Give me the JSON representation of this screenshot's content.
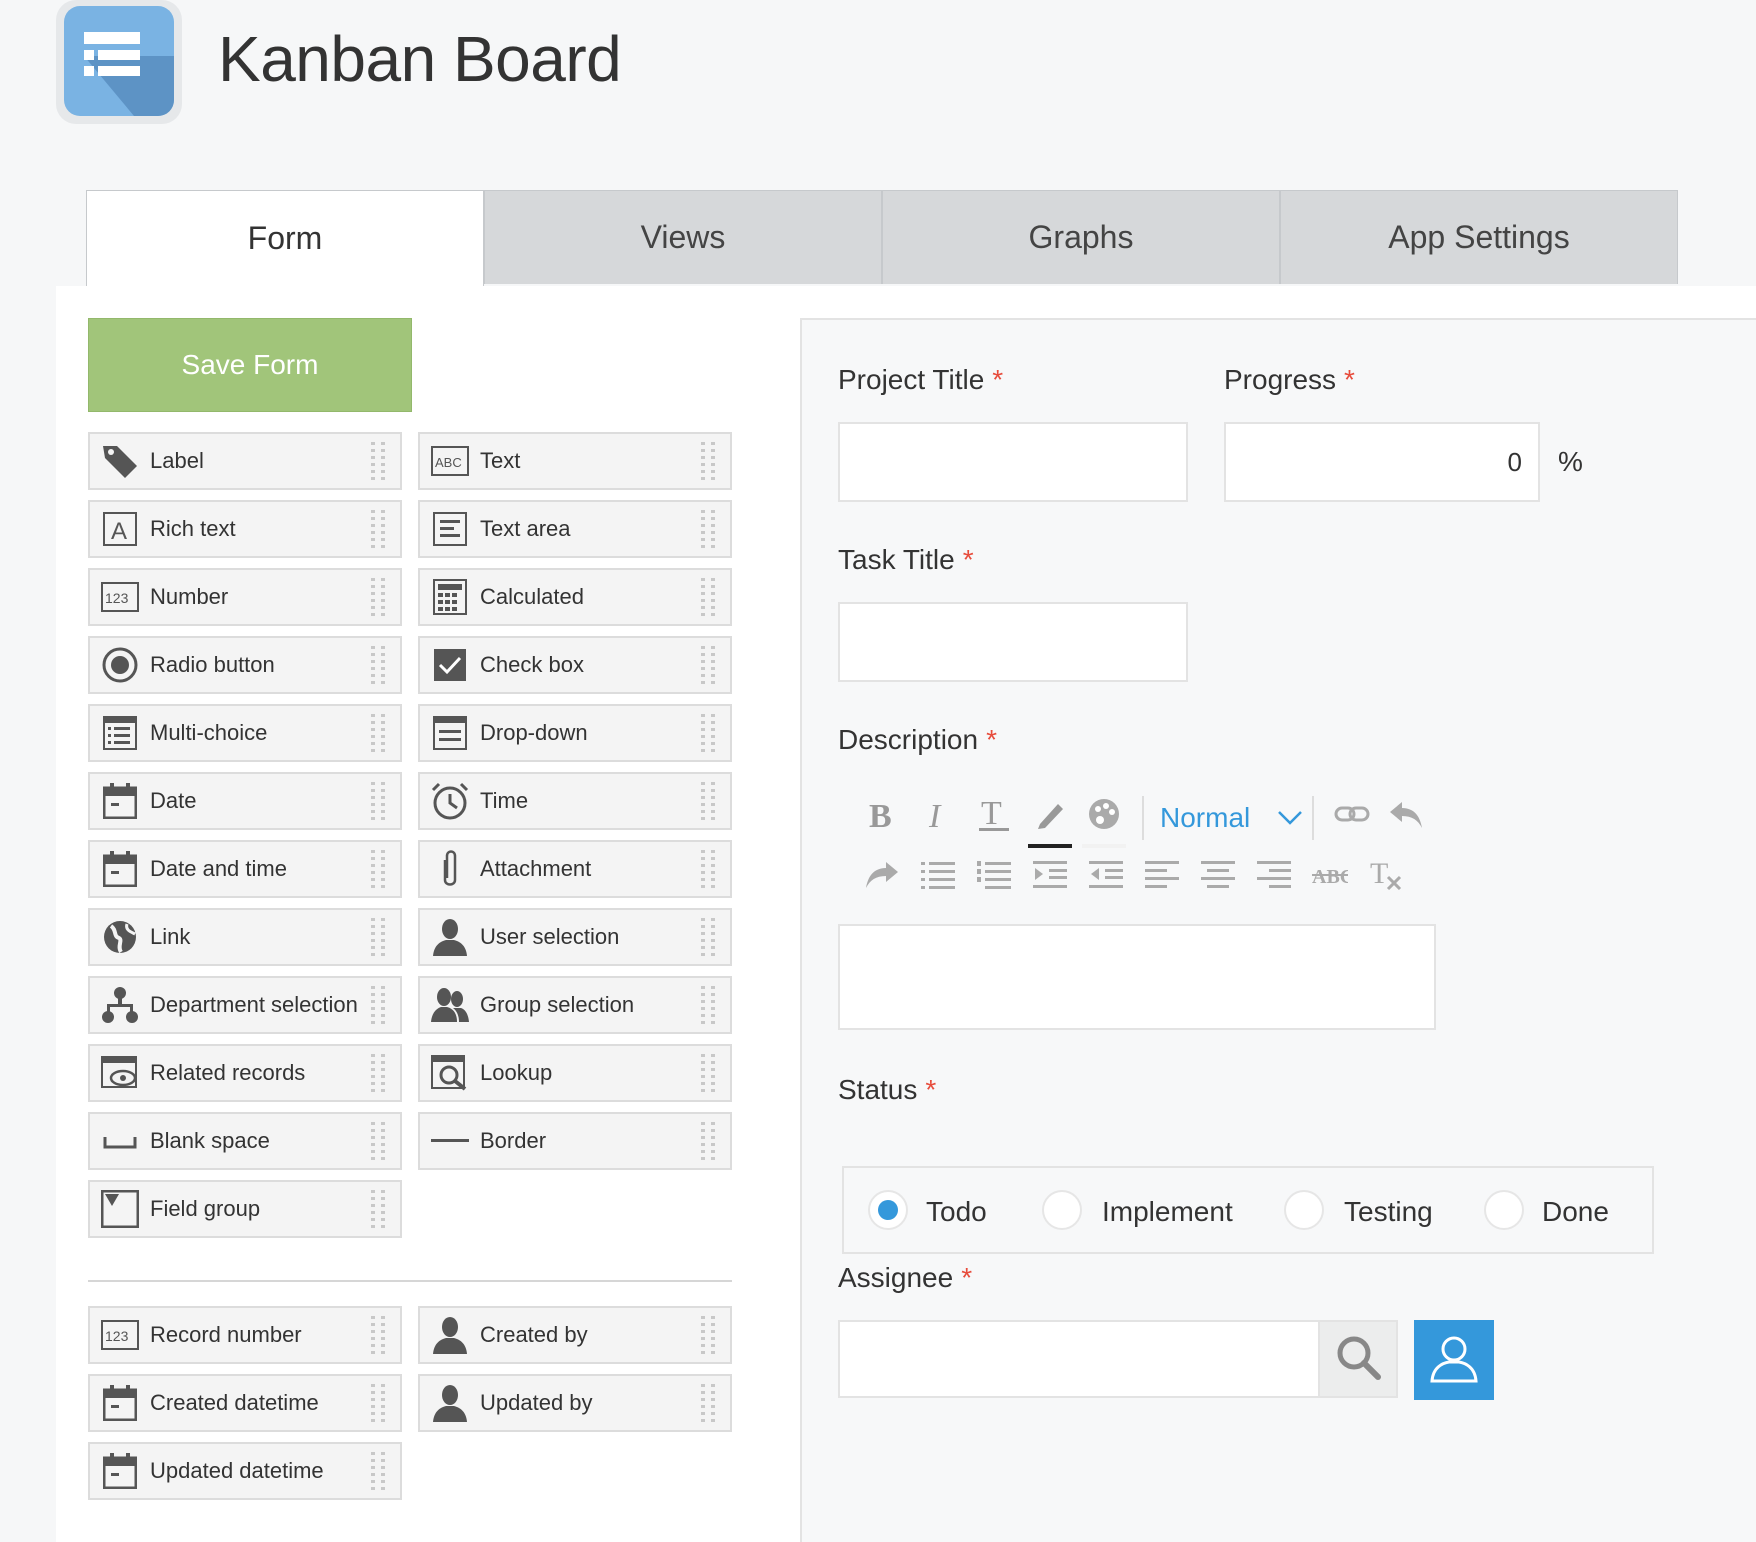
{
  "app": {
    "title": "Kanban Board",
    "icon": "list-icon",
    "icon_color": "#7ab3e3"
  },
  "tabs": [
    {
      "label": "Form",
      "active": true
    },
    {
      "label": "Views",
      "active": false
    },
    {
      "label": "Graphs",
      "active": false
    },
    {
      "label": "App Settings",
      "active": false
    }
  ],
  "toolbar": {
    "save_label": "Save Form",
    "save_color": "#a1c57a"
  },
  "palette": {
    "fields": [
      {
        "label": "Label",
        "icon": "tag-icon"
      },
      {
        "label": "Text",
        "icon": "abc-icon"
      },
      {
        "label": "Rich text",
        "icon": "rich-text-icon"
      },
      {
        "label": "Text area",
        "icon": "text-area-icon"
      },
      {
        "label": "Number",
        "icon": "number-icon"
      },
      {
        "label": "Calculated",
        "icon": "calculator-icon"
      },
      {
        "label": "Radio button",
        "icon": "radio-icon"
      },
      {
        "label": "Check box",
        "icon": "checkbox-icon"
      },
      {
        "label": "Multi-choice",
        "icon": "multi-choice-icon"
      },
      {
        "label": "Drop-down",
        "icon": "dropdown-icon"
      },
      {
        "label": "Date",
        "icon": "calendar-icon"
      },
      {
        "label": "Time",
        "icon": "clock-icon"
      },
      {
        "label": "Date and time",
        "icon": "calendar-icon"
      },
      {
        "label": "Attachment",
        "icon": "paperclip-icon"
      },
      {
        "label": "Link",
        "icon": "globe-icon"
      },
      {
        "label": "User selection",
        "icon": "user-icon"
      },
      {
        "label": "Department selection",
        "icon": "org-chart-icon"
      },
      {
        "label": "Group selection",
        "icon": "group-icon"
      },
      {
        "label": "Related records",
        "icon": "related-records-icon"
      },
      {
        "label": "Lookup",
        "icon": "lookup-icon"
      },
      {
        "label": "Blank space",
        "icon": "blank-space-icon"
      },
      {
        "label": "Border",
        "icon": "border-icon"
      },
      {
        "label": "Field group",
        "icon": "field-group-icon"
      }
    ],
    "system_fields": [
      {
        "label": "Record number",
        "icon": "number-icon"
      },
      {
        "label": "Created by",
        "icon": "user-icon"
      },
      {
        "label": "Created datetime",
        "icon": "calendar-icon"
      },
      {
        "label": "Updated by",
        "icon": "user-icon"
      },
      {
        "label": "Updated datetime",
        "icon": "calendar-icon"
      }
    ]
  },
  "form": {
    "required_mark": "*",
    "project_title": {
      "label": "Project Title",
      "value": ""
    },
    "progress": {
      "label": "Progress",
      "value": "0",
      "unit": "%"
    },
    "task_title": {
      "label": "Task Title",
      "value": ""
    },
    "description": {
      "label": "Description",
      "value": "",
      "editor": {
        "format_select": "Normal",
        "buttons_row1": [
          "bold-icon",
          "italic-icon",
          "text-size-icon",
          "text-color-icon",
          "background-color-icon"
        ],
        "buttons_row1_after": [
          "link-icon",
          "undo-icon"
        ],
        "buttons_row2": [
          "redo-icon",
          "bullet-list-icon",
          "numbered-list-icon",
          "indent-icon",
          "outdent-icon",
          "align-left-icon",
          "align-center-icon",
          "align-right-icon",
          "strikethrough-icon",
          "clear-format-icon"
        ]
      }
    },
    "status": {
      "label": "Status",
      "options": [
        "Todo",
        "Implement",
        "Testing",
        "Done"
      ],
      "selected": "Todo"
    },
    "assignee": {
      "label": "Assignee",
      "value": ""
    }
  },
  "colors": {
    "accent": "#3498db",
    "required": "#e74c3c"
  }
}
